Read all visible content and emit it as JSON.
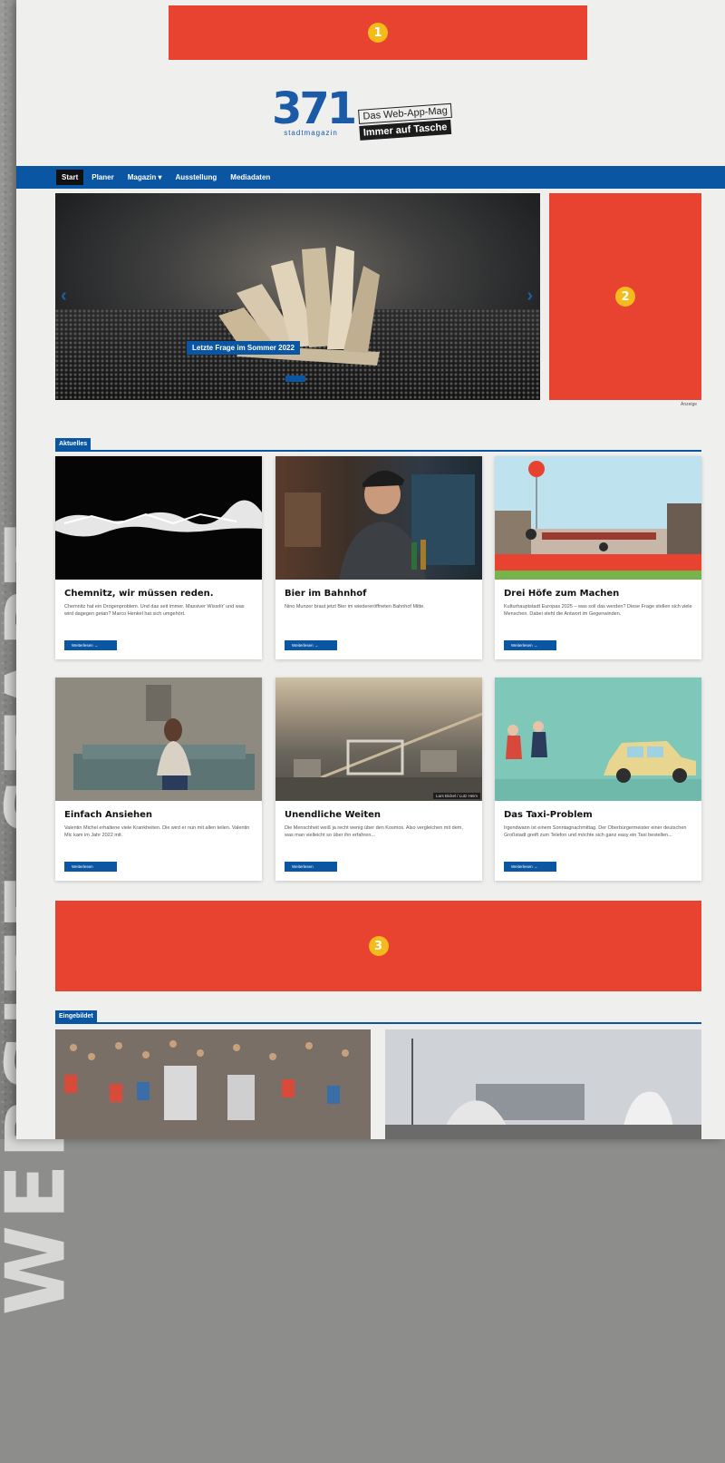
{
  "side_text": "WEBSITE START",
  "ads": [
    {
      "number": "1"
    },
    {
      "number": "2"
    },
    {
      "number": "3"
    }
  ],
  "ad_note": "Anzeige",
  "logo": {
    "number": "371",
    "subtitle": "stadtmagazin",
    "tagline_top": "Das Web-App-Mag",
    "tagline_bottom": "Immer auf Tasche"
  },
  "nav": {
    "items": [
      {
        "label": "Start",
        "active": true
      },
      {
        "label": "Planer"
      },
      {
        "label": "Magazin ▾"
      },
      {
        "label": "Ausstellung"
      },
      {
        "label": "Mediadaten"
      }
    ]
  },
  "hero": {
    "caption": "Letzte Frage im Sommer 2022",
    "prev_icon": "‹",
    "next_icon": "›"
  },
  "sections": {
    "aktuelles": "Aktuelles",
    "eingebildet": "Eingebildet"
  },
  "cards": [
    {
      "title": "Chemnitz, wir müssen reden.",
      "text": "Chemnitz hat ein Drogenproblem. Und das seit immer. Massiver Wissrlir' und was wird dagegen getan? Marco Henkel hat sich umgehört.",
      "button": "Weiterlesen →"
    },
    {
      "title": "Bier im Bahnhof",
      "text": "Nino Munzer braut jetzt Bier im wiedereröffneten Bahnhof Mitte.",
      "button": "Weiterlesen →"
    },
    {
      "title": "Drei Höfe zum Machen",
      "text": "Kulturhauptstadt Europas 2025 – was soll das werden? Diese Frage stellen sich viele Menschen. Dabei steht die Antwort im Gegenwinden.",
      "button": "Weiterlesen →"
    },
    {
      "title": "Einfach Ansiehen",
      "text": "Valentin Michel erhaltene viele Krankheiten. Die wird er nun mit allen teilen. Valentin Mic kam im Jahr 2022 mit.",
      "button": "Weiterlesen"
    },
    {
      "title": "Unendliche Weiten",
      "text": "Die Menschheit weiß ja recht wenig über den Kosmos. Also vergleichen mit dem, was man vielleicht so über ihn erfahren...",
      "button": "Weiterlesen",
      "credit": "Lars Bickel / Lutz Heim"
    },
    {
      "title": "Das Taxi-Problem",
      "text": "Irgendwann ist einem Sonntagnachmittag. Der Oberbürgermeister einer deutschen Großstadt greift zum Telefon und möchte sich ganz easy ein Taxi bestellen...",
      "button": "Weiterlesen →"
    }
  ],
  "colors": {
    "brand_blue": "#0a56a2",
    "ad_red": "#e84331",
    "marker_yellow": "#f4bb1a"
  }
}
